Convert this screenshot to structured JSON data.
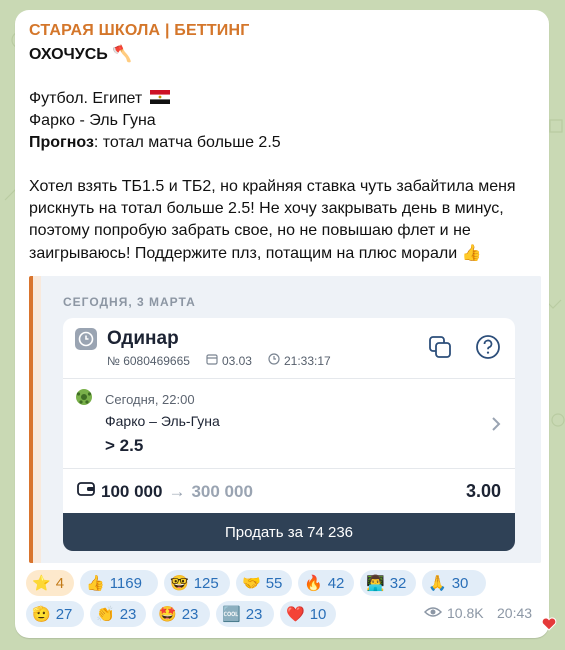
{
  "channel_name": "СТАРАЯ ШКОЛА | БЕТТИНГ",
  "post": {
    "headline": "ОХОЧУСЬ",
    "headline_emoji": "🪓",
    "sport_line": "Футбол. Египет",
    "flag_emoji": "🇪🇬",
    "match_line": "Фарко - Эль Гуна",
    "forecast_label": "Прогноз",
    "forecast_value": ": тотал матча больше 2.5",
    "body_line1": "Хотел взять ТБ1.5 и ТБ2, но крайняя ставка чуть забайтила меня",
    "body_line2": "рискнуть на тотал больше 2.5! Не хочу закрывать день в минус,",
    "body_line3": "поэтому попробую забрать свое, но не повышаю флет и не",
    "body_line4": "заигрываюсь! Поддержите плз, потащим на плюс морали",
    "body_emoji": "👍"
  },
  "bet_card": {
    "date_label": "СЕГОДНЯ, 3 МАРТА",
    "type": "Одинар",
    "number": "№ 6080469665",
    "date": "03.03",
    "time": "21:33:17",
    "event_time": "Сегодня, 22:00",
    "event_name": "Фарко – Эль-Гуна",
    "selection": "> 2.5",
    "stake": "100 000",
    "arrow": "→",
    "payout": "300 000",
    "coefficient": "3.00",
    "sell_button": "Продать за 74 236"
  },
  "reactions": [
    {
      "emoji": "⭐",
      "count": "4",
      "mine": true
    },
    {
      "emoji": "👍",
      "count": "1169"
    },
    {
      "emoji": "🤓",
      "count": "125"
    },
    {
      "emoji": "🤝",
      "count": "55"
    },
    {
      "emoji": "🔥",
      "count": "42"
    },
    {
      "emoji": "👨‍💻",
      "count": "32"
    },
    {
      "emoji": "🙏",
      "count": "30"
    },
    {
      "emoji": "🫡",
      "count": "27"
    },
    {
      "emoji": "👏",
      "count": "23"
    },
    {
      "emoji": "🤩",
      "count": "23"
    },
    {
      "emoji": "🆒",
      "count": "23"
    },
    {
      "emoji": "❤️",
      "count": "10"
    }
  ],
  "views": "10.8K",
  "post_time": "20:43",
  "colors": {
    "channel": "#d4762a",
    "button": "#2f4156",
    "reaction_bg": "#e2edf8",
    "reaction_text": "#2a6fb8"
  }
}
